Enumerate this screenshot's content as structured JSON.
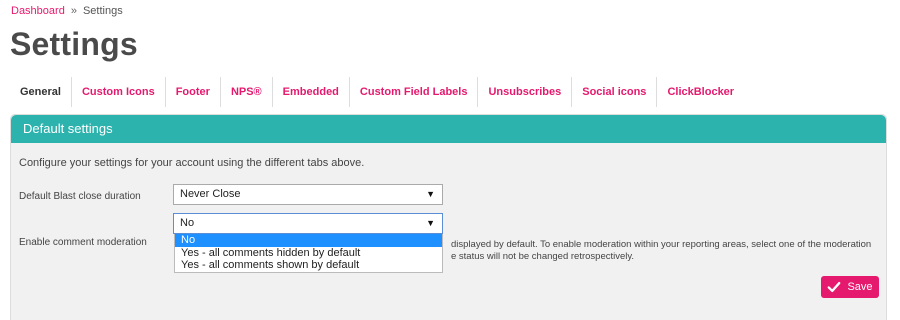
{
  "breadcrumb": {
    "home": "Dashboard",
    "separator": "»",
    "current": "Settings"
  },
  "page": {
    "title": "Settings"
  },
  "tabs": [
    {
      "label": "General",
      "active": true
    },
    {
      "label": "Custom Icons",
      "active": false
    },
    {
      "label": "Footer",
      "active": false
    },
    {
      "label": "NPS®",
      "active": false
    },
    {
      "label": "Embedded",
      "active": false
    },
    {
      "label": "Custom Field Labels",
      "active": false
    },
    {
      "label": "Unsubscribes",
      "active": false
    },
    {
      "label": "Social icons",
      "active": false
    },
    {
      "label": "ClickBlocker",
      "active": false
    }
  ],
  "panel": {
    "header": "Default settings",
    "intro": "Configure your settings for your account using the different tabs above.",
    "blast_close": {
      "label": "Default Blast close duration",
      "value": "Never Close"
    },
    "comment_moderation": {
      "label": "Enable comment moderation",
      "value": "No",
      "options": [
        "No",
        "Yes - all comments hidden by default",
        "Yes - all comments shown by default"
      ],
      "help_line1": "displayed by default. To enable moderation within your reporting areas, select one of the moderation",
      "help_line2": "e status will not be changed retrospectively."
    },
    "save_label": "Save"
  },
  "colors": {
    "accent": "#e5196e",
    "header": "#2db3ad",
    "selected_option": "#1e90ff"
  },
  "icons": {
    "dropdown_arrow": "triangle-down-icon",
    "save": "check-icon"
  }
}
